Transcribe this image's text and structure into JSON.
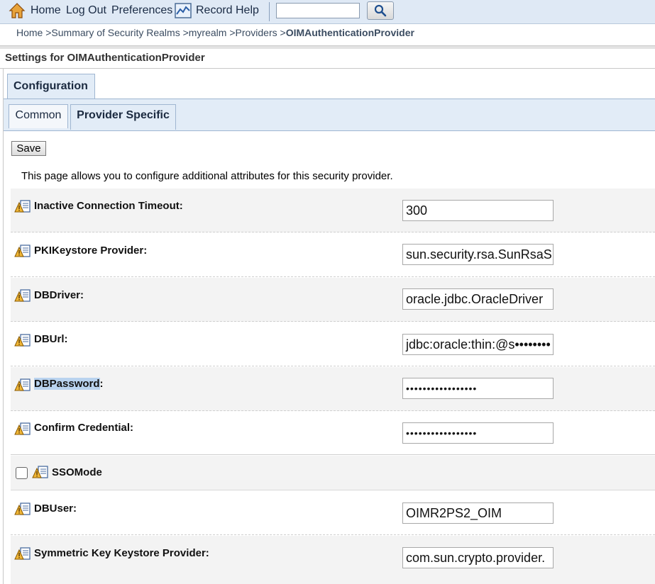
{
  "toolbar": {
    "home_label": "Home",
    "logout_label": "Log Out",
    "preferences_label": "Preferences",
    "record_label": "Record",
    "help_label": "Help",
    "search_value": ""
  },
  "breadcrumb": {
    "items": [
      "Home >",
      "Summary of Security Realms >",
      "myrealm >",
      "Providers >"
    ],
    "current": "OIMAuthenticationProvider"
  },
  "settings_title": "Settings for OIMAuthenticationProvider",
  "tabs": {
    "main": "Configuration",
    "sub": [
      "Common",
      "Provider Specific"
    ]
  },
  "save_label": "Save",
  "intro": "This page allows you to configure additional attributes for this security provider.",
  "fields": {
    "inactive_timeout": {
      "label": "Inactive Connection Timeout:",
      "value": "300"
    },
    "pki_keystore": {
      "label": "PKIKeystore Provider:",
      "value": "sun.security.rsa.SunRsaS"
    },
    "db_driver": {
      "label": "DBDriver:",
      "value": "oracle.jdbc.OracleDriver"
    },
    "db_url": {
      "label": "DBUrl:",
      "value": "jdbc:oracle:thin:@s••••••••"
    },
    "db_password": {
      "label": "DBPassword",
      "label_suffix": ":",
      "value": "•••••••••••••••••"
    },
    "confirm_credential": {
      "label": "Confirm Credential:",
      "value": "•••••••••••••••••"
    },
    "sso_mode": {
      "label": "SSOMode",
      "checked": false
    },
    "db_user": {
      "label": "DBUser:",
      "value": "OIMR2PS2_OIM"
    },
    "symmetric_keystore": {
      "label": "Symmetric Key Keystore Provider:",
      "value": "com.sun.crypto.provider."
    }
  },
  "colors": {
    "toolbar_bg": "#dfe9f5",
    "tab_bg": "#e2ecf7",
    "row_grey": "#f3f3f3",
    "selection": "#b9d3ef"
  }
}
